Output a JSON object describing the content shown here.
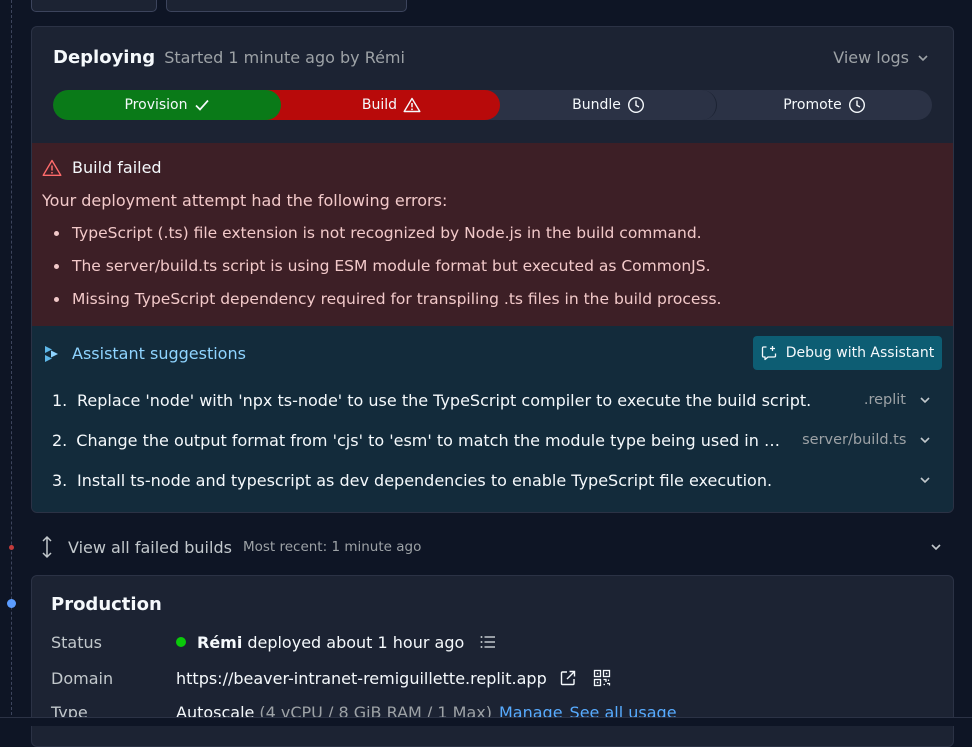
{
  "deploy": {
    "title": "Deploying",
    "subtitle": "Started 1 minute ago by Rémi",
    "view_logs": "View logs"
  },
  "steps": [
    {
      "label": "Provision",
      "status": "success",
      "icon": "check-icon"
    },
    {
      "label": "Build",
      "status": "failed",
      "icon": "warning-icon"
    },
    {
      "label": "Bundle",
      "status": "pending",
      "icon": "clock-icon"
    },
    {
      "label": "Promote",
      "status": "pending",
      "icon": "clock-icon"
    }
  ],
  "error": {
    "title": "Build failed",
    "intro": "Your deployment attempt had the following errors:",
    "items": [
      "TypeScript (.ts) file extension is not recognized by Node.js in the build command.",
      "The server/build.ts script is using ESM module format but executed as CommonJS.",
      "Missing TypeScript dependency required for transpiling .ts files in the build process."
    ]
  },
  "assistant": {
    "title": "Assistant suggestions",
    "debug_button": "Debug with Assistant",
    "suggestions": [
      {
        "num": "1.",
        "text": "Replace 'node' with 'npx ts-node' to use the TypeScript compiler to execute the build script.",
        "file": ".replit"
      },
      {
        "num": "2.",
        "text": "Change the output format from 'cjs' to 'esm' to match the module type being used in the...",
        "file": "server/build.ts"
      },
      {
        "num": "3.",
        "text": "Install ts-node and typescript as dev dependencies to enable TypeScript file execution.",
        "file": ""
      }
    ]
  },
  "failed_builds": {
    "label": "View all failed builds",
    "recent": "Most recent: 1 minute ago"
  },
  "production": {
    "title": "Production",
    "status_label": "Status",
    "status_user": "Rémi",
    "status_text": "deployed about 1 hour ago",
    "domain_label": "Domain",
    "domain": "https://beaver-intranet-remiguillette.replit.app",
    "type_label": "Type",
    "type_value": "Autoscale",
    "type_spec": "(4 vCPU / 8 GiB RAM / 1 Max)",
    "manage": "Manage",
    "see_usage": "See all usage"
  },
  "colors": {
    "success": "#0a7a18",
    "failed": "#b80a0a",
    "link": "#57abff",
    "assistant": "#8fd4ff"
  }
}
